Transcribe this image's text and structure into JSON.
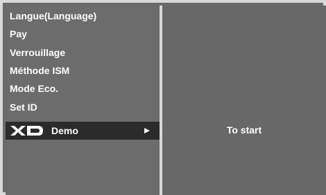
{
  "menu": {
    "items": [
      {
        "label": "Langue(Language)"
      },
      {
        "label": "Pay"
      },
      {
        "label": "Verrouillage"
      },
      {
        "label": "Méthode ISM"
      },
      {
        "label": "Mode Eco."
      },
      {
        "label": "Set ID"
      }
    ],
    "selected": {
      "logo_text": "XD",
      "label": "Demo",
      "icon": "play-arrow-icon"
    }
  },
  "panel": {
    "text": "To start"
  },
  "colors": {
    "border": "#d9d9d9",
    "panel": "#6a6a6a",
    "selected": "#2b2b2b",
    "text": "#ffffff"
  }
}
